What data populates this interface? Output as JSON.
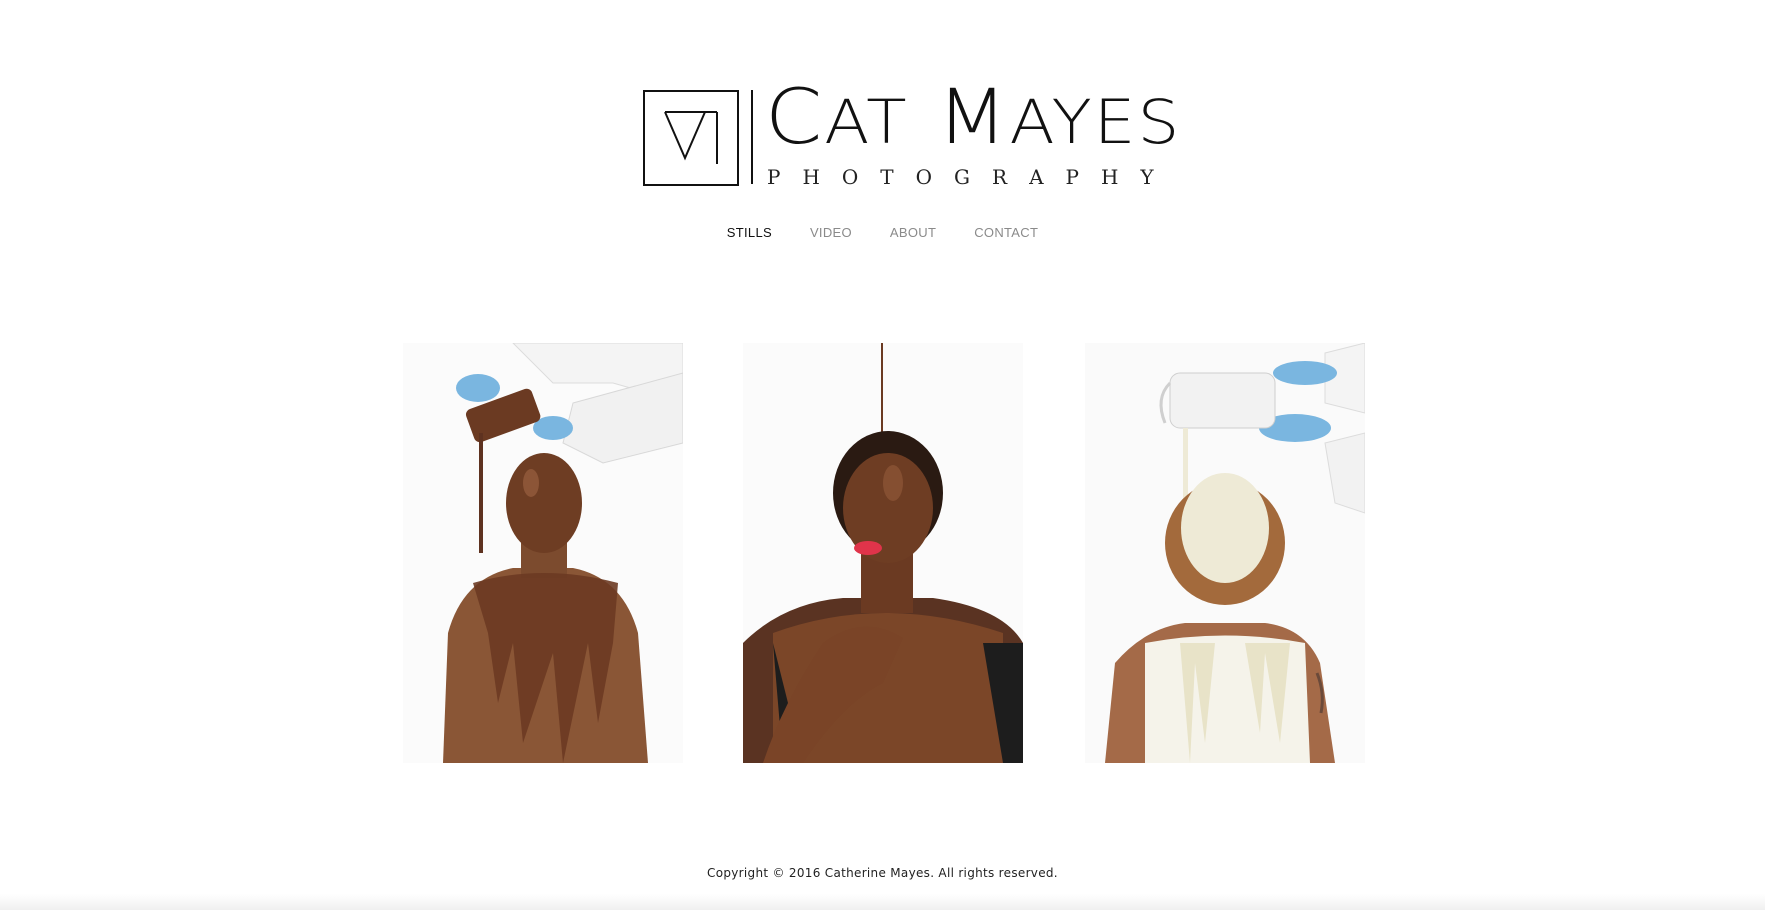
{
  "brand": {
    "name_first_initial": "C",
    "name_rest_1": "AT",
    "name_space": " ",
    "name_second_initial": "M",
    "name_rest_2": "AYES",
    "tagline": "PHOTOGRAPHY"
  },
  "nav": {
    "items": [
      {
        "label": "STILLS",
        "active": true
      },
      {
        "label": "VIDEO",
        "active": false
      },
      {
        "label": "ABOUT",
        "active": false
      },
      {
        "label": "CONTACT",
        "active": false
      }
    ]
  },
  "gallery": {
    "photos": [
      {
        "subject": "chocolate-pour-portrait"
      },
      {
        "subject": "chocolate-drip-portrait"
      },
      {
        "subject": "milk-pour-portrait"
      }
    ]
  },
  "footer": {
    "copyright": "Copyright © 2016 Catherine Mayes. All rights reserved."
  },
  "colors": {
    "nav_active": "#111111",
    "nav_inactive": "#8a8a8a",
    "chocolate": "#6b3a22",
    "skin": "#8a5636",
    "glove": "#7ab6e0",
    "milk": "#eeead6"
  }
}
